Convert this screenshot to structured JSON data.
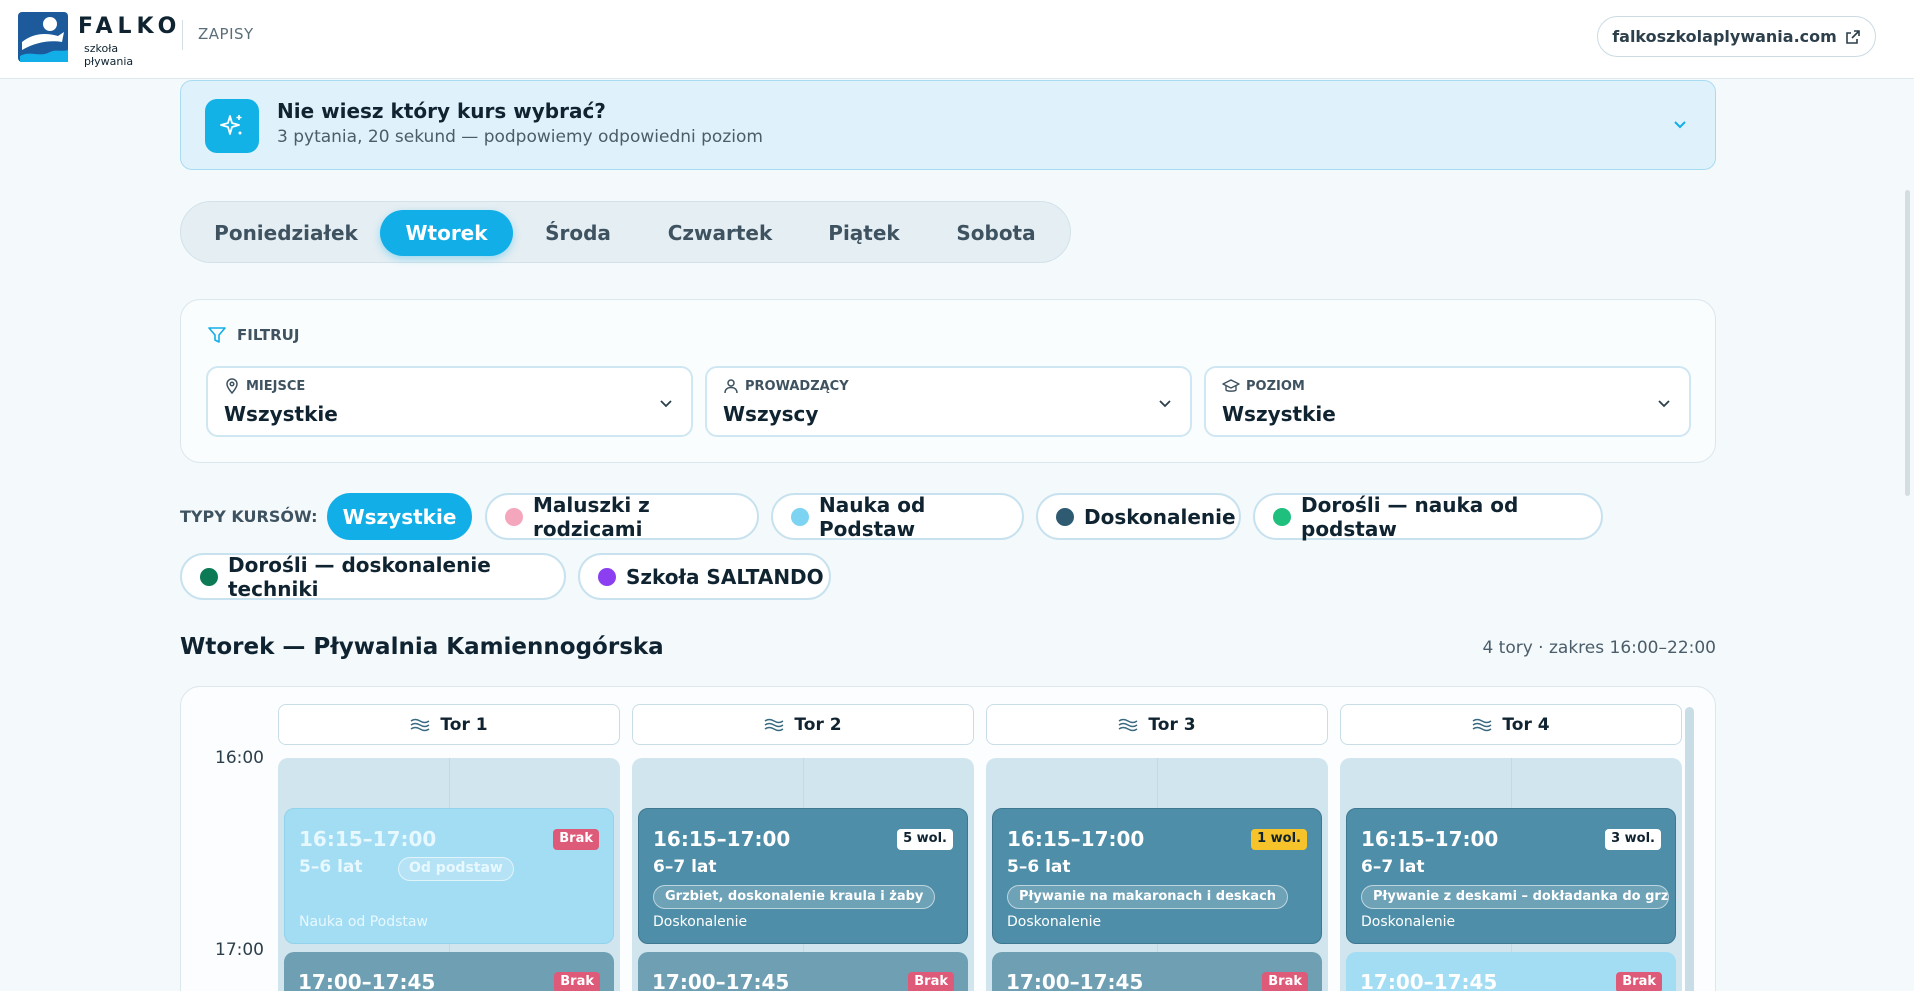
{
  "header": {
    "logo_name": "FALKO",
    "logo_sub": "szkoła pływania",
    "nav_label": "ZAPISY",
    "site_link": "falkoszkolaplywania.com"
  },
  "quiz": {
    "title": "Nie wiesz który kurs wybrać?",
    "subtitle": "3 pytania, 20 sekund — podpowiemy odpowiedni poziom"
  },
  "days": [
    "Poniedziałek",
    "Wtorek",
    "Środa",
    "Czwartek",
    "Piątek",
    "Sobota"
  ],
  "active_day": "Wtorek",
  "filter": {
    "title": "FILTRUJ",
    "selects": [
      {
        "label": "MIEJSCE",
        "value": "Wszystkie"
      },
      {
        "label": "PROWADZĄCY",
        "value": "Wszyscy"
      },
      {
        "label": "POZIOM",
        "value": "Wszystkie"
      }
    ]
  },
  "types": {
    "label": "TYPY KURSÓW:",
    "items": [
      {
        "label": "Wszystkie",
        "color": "#12aee8"
      },
      {
        "label": "Maluszki z rodzicami",
        "color": "#f4a6bd"
      },
      {
        "label": "Nauka od Podstaw",
        "color": "#7dd3f2"
      },
      {
        "label": "Doskonalenie",
        "color": "#2f5b72"
      },
      {
        "label": "Dorośli — nauka od podstaw",
        "color": "#1fbf7e"
      },
      {
        "label": "Dorośli — doskonalenie techniki",
        "color": "#0b7a55"
      },
      {
        "label": "Szkoła SALTANDO",
        "color": "#8b3ff0"
      }
    ]
  },
  "schedule": {
    "title": "Wtorek — Pływalnia Kamiennogórska",
    "meta": "4 tory · zakres 16:00–22:00",
    "times": [
      "16:00",
      "17:00"
    ],
    "lanes": [
      "Tor 1",
      "Tor 2",
      "Tor 3",
      "Tor 4"
    ],
    "cards": [
      {
        "time": "16:15–17:00",
        "age": "5–6 lat",
        "level": "Od podstaw",
        "type": "Nauka od Podstaw",
        "badge": "Brak"
      },
      {
        "time": "16:15–17:00",
        "age": "6–7 lat",
        "pill": "Grzbiet, doskonalenie kraula i żaby",
        "type": "Doskonalenie",
        "badge": "5 wol."
      },
      {
        "time": "16:15–17:00",
        "age": "5–6 lat",
        "pill": "Pływanie na makaronach i deskach",
        "type": "Doskonalenie",
        "badge": "1 wol."
      },
      {
        "time": "16:15–17:00",
        "age": "6–7 lat",
        "pill": "Pływanie z deskami – dokładanka do grzbietu",
        "type": "Doskonalenie",
        "badge": "3 wol."
      }
    ],
    "next_cards": [
      {
        "time": "17:00–17:45",
        "badge": "Brak"
      },
      {
        "time": "17:00–17:45",
        "badge": "Brak"
      },
      {
        "time": "17:00–17:45",
        "badge": "Brak"
      },
      {
        "time": "17:00–17:45",
        "badge": "Brak"
      }
    ]
  }
}
